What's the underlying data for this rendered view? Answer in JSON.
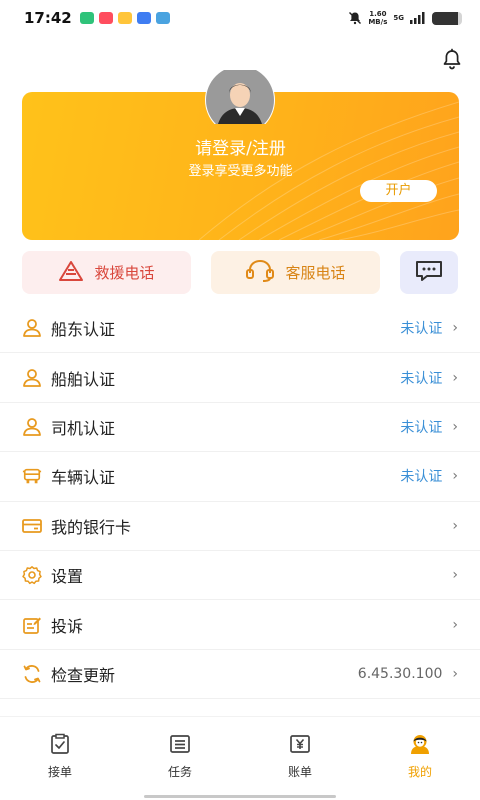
{
  "status": {
    "time": "17:42",
    "net_speed_value": "1.60",
    "net_speed_unit": "MB/s",
    "network": "5G",
    "battery_level": 0.85
  },
  "hero": {
    "title": "请登录/注册",
    "subtitle": "登录享受更多功能",
    "open_button": "开户"
  },
  "quick_actions": {
    "rescue": "救援电话",
    "service": "客服电话"
  },
  "menu": [
    {
      "label": "船东认证",
      "value": "未认证",
      "icon": "person-icon"
    },
    {
      "label": "船舶认证",
      "value": "未认证",
      "icon": "person-icon"
    },
    {
      "label": "司机认证",
      "value": "未认证",
      "icon": "person-icon"
    },
    {
      "label": "车辆认证",
      "value": "未认证",
      "icon": "truck-icon"
    },
    {
      "label": "我的银行卡",
      "value": "",
      "icon": "bank-card-icon"
    },
    {
      "label": "设置",
      "value": "",
      "icon": "gear-icon"
    },
    {
      "label": "投诉",
      "value": "",
      "icon": "complaint-icon"
    },
    {
      "label": "检查更新",
      "value": "6.45.30.100",
      "icon": "refresh-icon"
    }
  ],
  "tabs": [
    {
      "label": "接单",
      "active": false
    },
    {
      "label": "任务",
      "active": false
    },
    {
      "label": "账单",
      "active": false
    },
    {
      "label": "我的",
      "active": true
    }
  ],
  "colors": {
    "accent": "#f0a000",
    "link": "#3a8fd6",
    "hero_start": "#ffc21a",
    "hero_end": "#ffa31c"
  }
}
